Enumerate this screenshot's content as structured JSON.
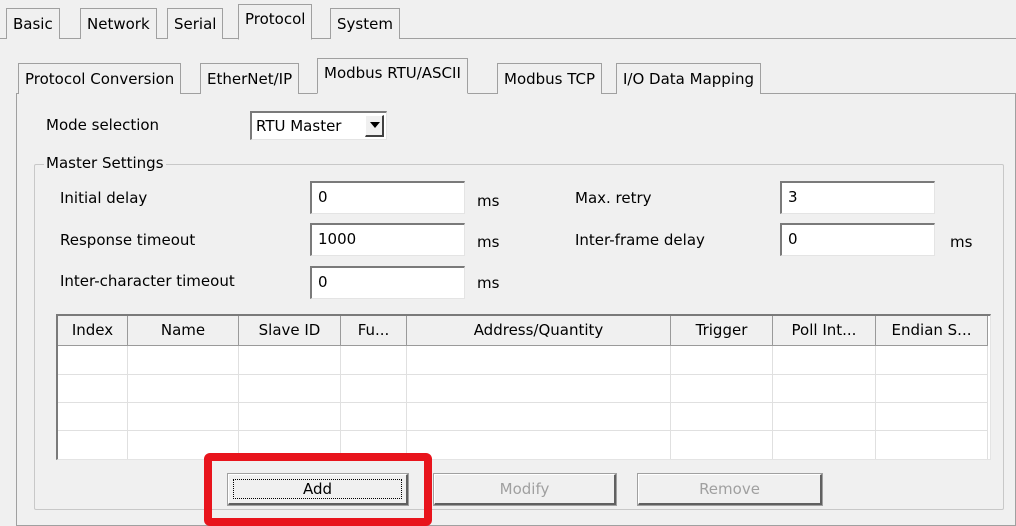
{
  "top_tabs": [
    "Basic",
    "Network",
    "Serial",
    "Protocol",
    "System"
  ],
  "active_top_tab": "Protocol",
  "sub_tabs": [
    "Protocol Conversion",
    "EtherNet/IP",
    "Modbus RTU/ASCII",
    "Modbus TCP",
    "I/O Data Mapping"
  ],
  "active_sub_tab": "Modbus RTU/ASCII",
  "mode": {
    "label": "Mode selection",
    "value": "RTU Master"
  },
  "master": {
    "title": "Master Settings",
    "initial_delay": {
      "label": "Initial delay",
      "value": "0",
      "unit": "ms"
    },
    "response_timeout": {
      "label": "Response timeout",
      "value": "1000",
      "unit": "ms"
    },
    "inter_char_timeout": {
      "label": "Inter-character timeout",
      "value": "0",
      "unit": "ms"
    },
    "max_retry": {
      "label": "Max. retry",
      "value": "3"
    },
    "inter_frame_delay": {
      "label": "Inter-frame delay",
      "value": "0",
      "unit": "ms"
    }
  },
  "table": {
    "columns": [
      "Index",
      "Name",
      "Slave ID",
      "Fu...",
      "Address/Quantity",
      "Trigger",
      "Poll Int...",
      "Endian S..."
    ],
    "rows": []
  },
  "buttons": {
    "add": "Add",
    "modify": "Modify",
    "remove": "Remove"
  },
  "colors": {
    "highlight": "#e8141c"
  }
}
